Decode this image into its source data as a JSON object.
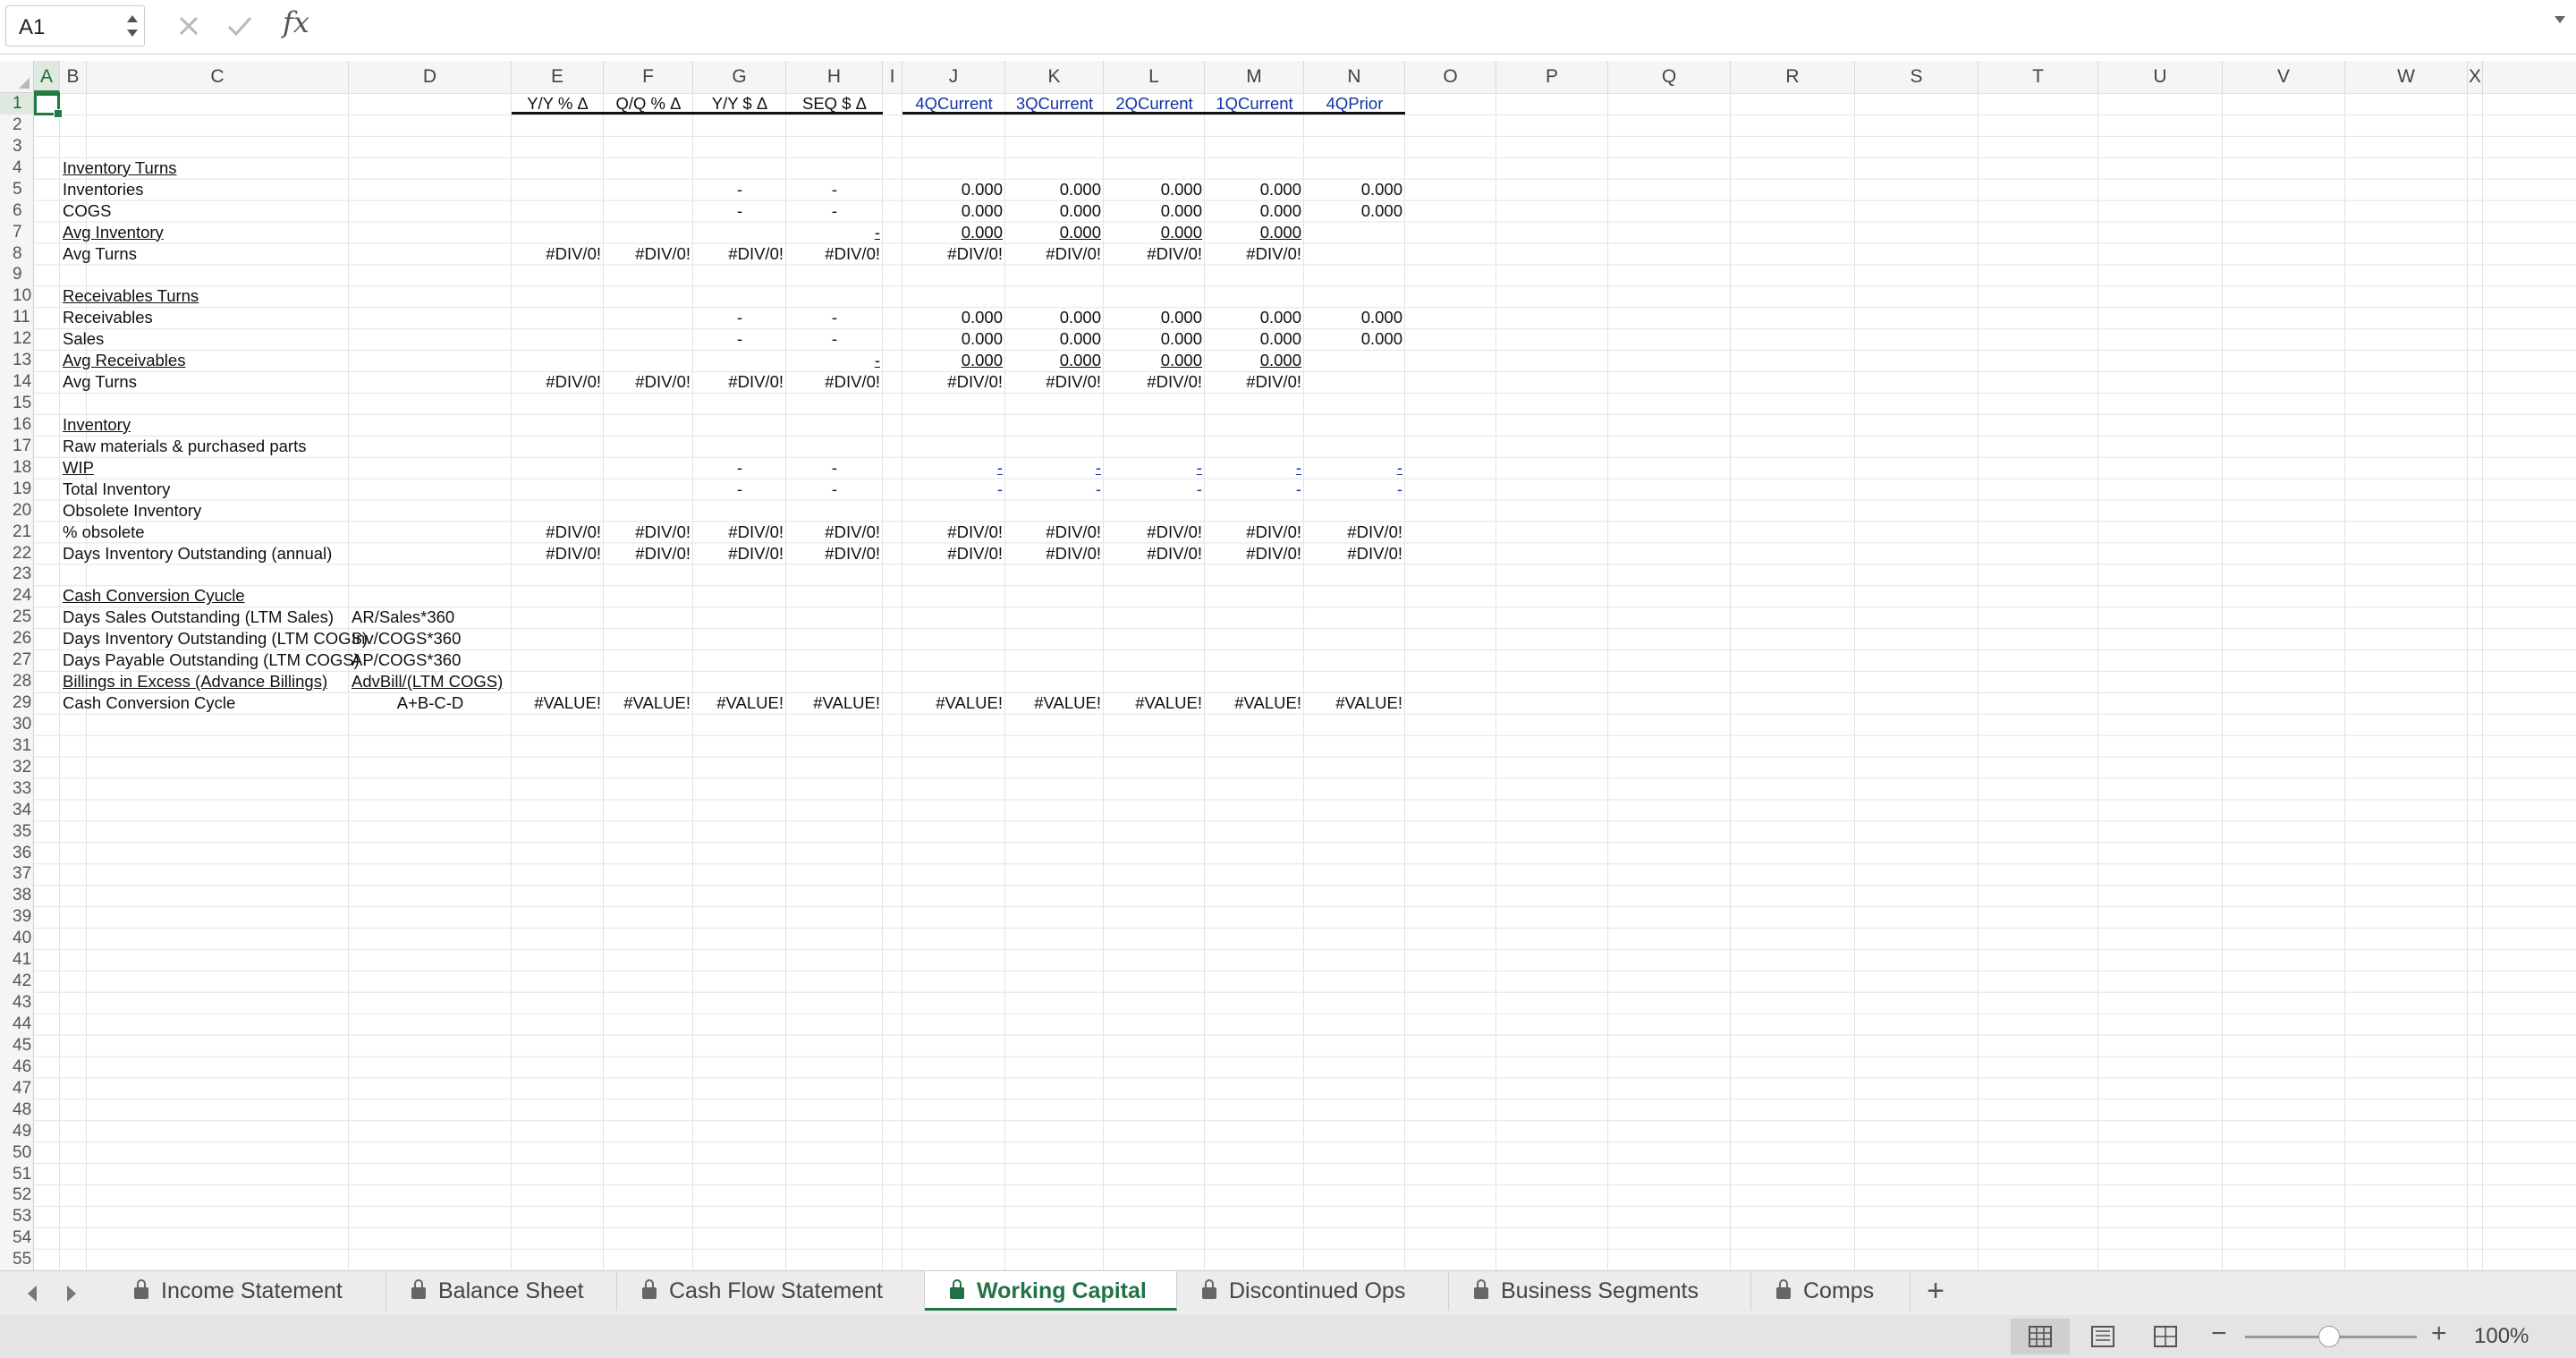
{
  "formula_bar": {
    "cell_reference": "A1",
    "cancel_icon": "x-icon",
    "enter_icon": "check-icon",
    "function_label": "fx",
    "formula_value": ""
  },
  "columns": [
    "A",
    "B",
    "C",
    "D",
    "E",
    "F",
    "G",
    "H",
    "I",
    "J",
    "K",
    "L",
    "M",
    "N",
    "O",
    "P",
    "Q",
    "R",
    "S",
    "T",
    "U",
    "V",
    "W",
    "X"
  ],
  "rows": [
    "1",
    "2",
    "3",
    "4",
    "5",
    "6",
    "7",
    "8",
    "9",
    "10",
    "11",
    "12",
    "13",
    "14",
    "15",
    "16",
    "17",
    "18",
    "19",
    "20",
    "21",
    "22",
    "23",
    "24",
    "25",
    "26",
    "27",
    "28",
    "29",
    "30",
    "31",
    "32",
    "33",
    "34",
    "35",
    "36",
    "37",
    "38",
    "39",
    "40",
    "41",
    "42",
    "43",
    "44",
    "45",
    "46",
    "47",
    "48",
    "49",
    "50",
    "51",
    "52",
    "53",
    "54",
    "55"
  ],
  "header_row": {
    "E": "Y/Y % Δ",
    "F": "Q/Q % Δ",
    "G": "Y/Y $ Δ",
    "H": "SEQ $ Δ",
    "J": "4QCurrent",
    "K": "3QCurrent",
    "L": "2QCurrent",
    "M": "1QCurrent",
    "N": "4QPrior"
  },
  "labels": {
    "r4": "Inventory Turns",
    "r5": "Inventories",
    "r6": "COGS",
    "r7": "Avg Inventory",
    "r8": "Avg Turns",
    "r10": "Receivables Turns",
    "r11": "Receivables",
    "r12": "Sales",
    "r13": "Avg Receivables",
    "r14": "Avg Turns",
    "r16": "Inventory",
    "r17": "Raw materials & purchased parts",
    "r18": "WIP",
    "r19": "Total Inventory",
    "r20": "Obsolete Inventory",
    "r21": "% obsolete",
    "r22": "Days Inventory Outstanding (annual)",
    "r24": "Cash Conversion Cyucle",
    "r25": "Days Sales Outstanding (LTM Sales)",
    "r26": "Days Inventory Outstanding (LTM COGS)",
    "r27": "Days Payable Outstanding (LTM COGS)",
    "r28": "Billings in Excess (Advance Billings)",
    "r29": "Cash Conversion Cycle"
  },
  "formulas_d": {
    "r25": "AR/Sales*360",
    "r26": "Inv/COGS*360",
    "r27": "AP/COGS*360",
    "r28": "AdvBill/(LTM COGS)",
    "r29": "A+B-C-D"
  },
  "values": {
    "dash": "-",
    "zero": "0.000",
    "div0": "#DIV/0!",
    "value_err": "#VALUE!"
  },
  "sheets": [
    {
      "label": "Income Statement",
      "active": false
    },
    {
      "label": "Balance Sheet",
      "active": false
    },
    {
      "label": "Cash Flow Statement",
      "active": false
    },
    {
      "label": "Working Capital",
      "active": true
    },
    {
      "label": "Discontinued Ops",
      "active": false
    },
    {
      "label": "Business Segments",
      "active": false
    },
    {
      "label": "Comps",
      "active": false
    }
  ],
  "add_sheet_label": "+",
  "status": {
    "zoom_minus": "−",
    "zoom_plus": "+",
    "zoom_level": "100%"
  }
}
